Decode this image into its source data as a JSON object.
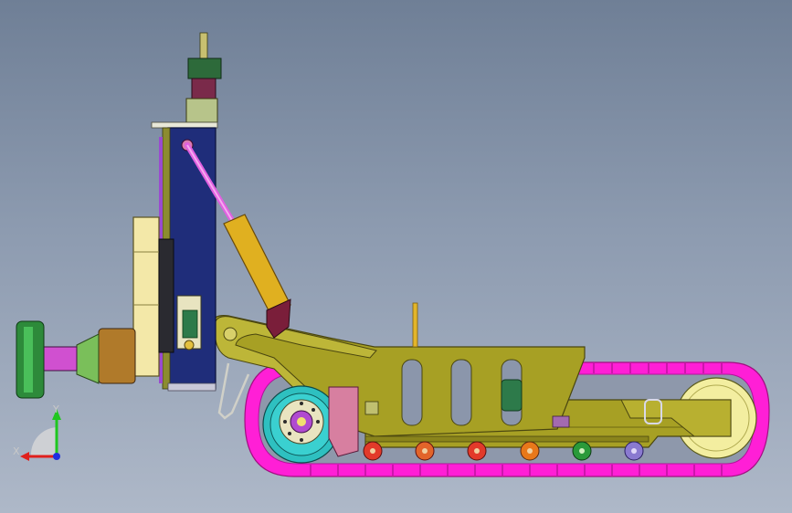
{
  "view": {
    "background_top": "#6f7f96",
    "background_bottom": "#aeb8c8"
  },
  "triad": {
    "x_label": "X",
    "y_label": "Y",
    "x_color": "#e0201c",
    "y_color": "#1fc71f",
    "z_color": "#1f2fe0"
  },
  "colors": {
    "track": "#ff1fd6",
    "chassis": "#a7a024",
    "chassis_dark": "#6f6a12",
    "mast": "#1f2d7a",
    "mast_edge": "#8c8c30",
    "cylinder": "#e0b020",
    "rod": "#e060e0",
    "bracket": "#7a1e3a",
    "housing": "#f3e8a8",
    "sprocket": "#2ec0c0",
    "wheel_colors": [
      "#e23a2a",
      "#e2642a",
      "#e2a02a",
      "#e8781a",
      "#2a9a3a",
      "#8a7ad0"
    ]
  }
}
